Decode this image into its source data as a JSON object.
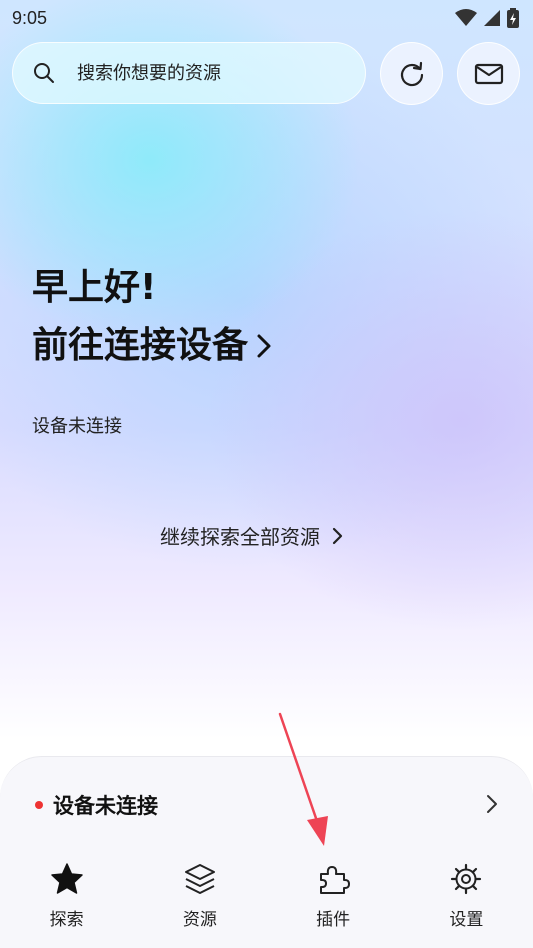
{
  "status_bar": {
    "time": "9:05"
  },
  "search": {
    "placeholder": "搜索你想要的资源"
  },
  "header_buttons": [
    {
      "name": "refresh",
      "icon": "refresh-icon"
    },
    {
      "name": "mail",
      "icon": "mail-icon"
    }
  ],
  "hero": {
    "greeting": "早上好!",
    "connect_label": "前往连接设备",
    "device_status": "设备未连接",
    "explore_label": "继续探索全部资源"
  },
  "bottom_sheet": {
    "device_row_label": "设备未连接",
    "status_color": "#ee3333"
  },
  "nav": {
    "items": [
      {
        "label": "探索",
        "icon": "star-icon"
      },
      {
        "label": "资源",
        "icon": "layers-icon"
      },
      {
        "label": "插件",
        "icon": "puzzle-icon"
      },
      {
        "label": "设置",
        "icon": "gear-icon"
      }
    ]
  },
  "colors": {
    "accent_red": "#ee3333",
    "arrow": "#ee4455"
  }
}
